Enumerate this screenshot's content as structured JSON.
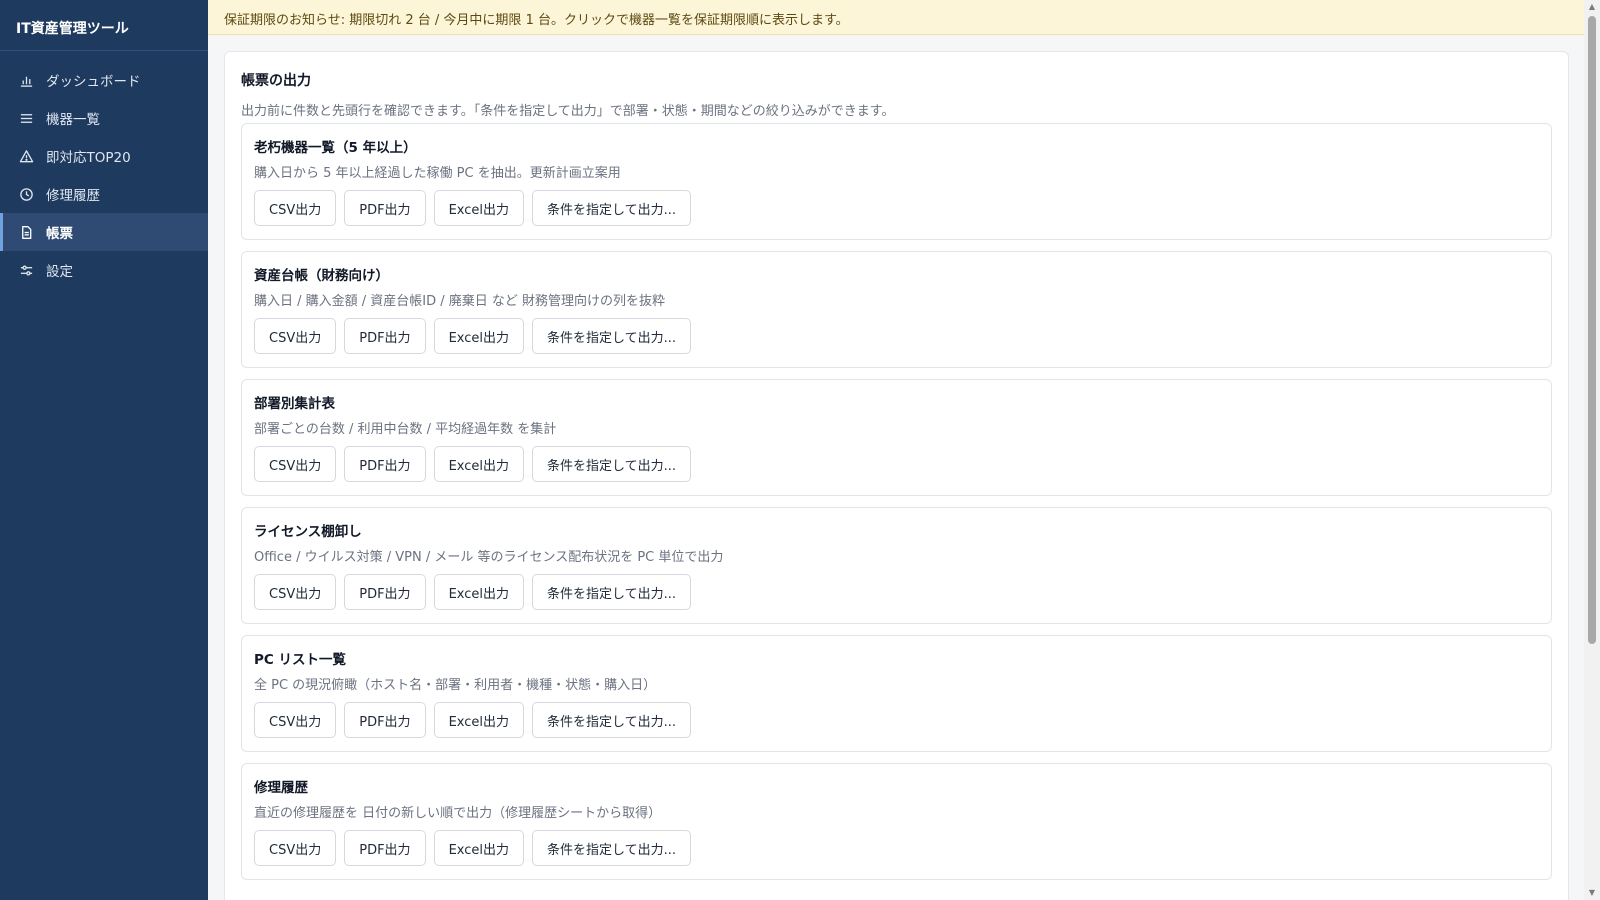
{
  "app": {
    "title": "IT資産管理ツール"
  },
  "sidebar": {
    "items": [
      {
        "label": "ダッシュボード",
        "icon": "bar-chart-icon"
      },
      {
        "label": "機器一覧",
        "icon": "list-icon"
      },
      {
        "label": "即対応TOP20",
        "icon": "warning-icon"
      },
      {
        "label": "修理履歴",
        "icon": "clock-icon"
      },
      {
        "label": "帳票",
        "icon": "document-icon",
        "active": true
      },
      {
        "label": "設定",
        "icon": "sliders-icon"
      }
    ]
  },
  "notice": {
    "text": "保証期限のお知らせ: 期限切れ 2 台 / 今月中に期限 1 台。クリックで機器一覧を保証期限順に表示します。"
  },
  "main": {
    "title": "帳票の出力",
    "description": "出力前に件数と先頭行を確認できます。「条件を指定して出力」で部署・状態・期間などの絞り込みができます。"
  },
  "buttons": {
    "csv": "CSV出力",
    "pdf": "PDF出力",
    "excel": "Excel出力",
    "custom": "条件を指定して出力..."
  },
  "reports": [
    {
      "title": "老朽機器一覧（5 年以上）",
      "description": "購入日から 5 年以上経過した稼働 PC を抽出。更新計画立案用"
    },
    {
      "title": "資産台帳（財務向け）",
      "description": "購入日 / 購入金額 / 資産台帳ID / 廃棄日 など 財務管理向けの列を抜粋"
    },
    {
      "title": "部署別集計表",
      "description": "部署ごとの台数 / 利用中台数 / 平均経過年数 を集計"
    },
    {
      "title": "ライセンス棚卸し",
      "description": "Office / ウイルス対策 / VPN / メール 等のライセンス配布状況を PC 単位で出力"
    },
    {
      "title": "PC リスト一覧",
      "description": "全 PC の現況俯瞰（ホスト名・部署・利用者・機種・状態・購入日）"
    },
    {
      "title": "修理履歴",
      "description": "直近の修理履歴を 日付の新しい順で出力（修理履歴シートから取得）"
    }
  ]
}
